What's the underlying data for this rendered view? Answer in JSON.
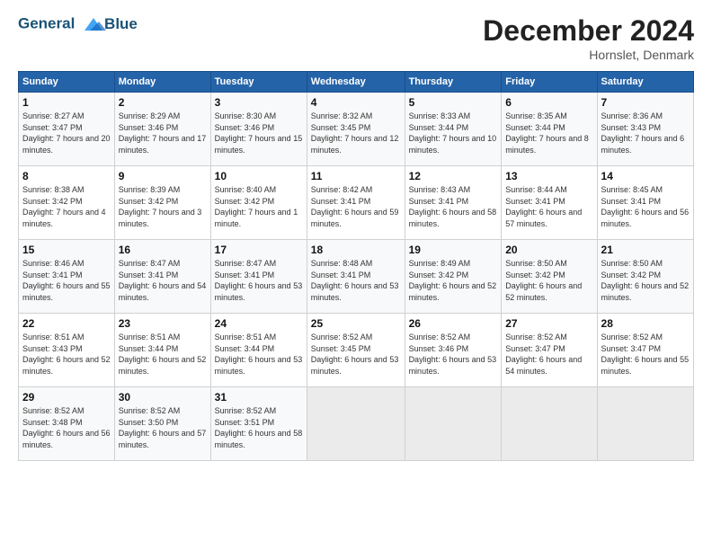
{
  "logo": {
    "line1": "General",
    "line2": "Blue"
  },
  "title": "December 2024",
  "location": "Hornslet, Denmark",
  "weekdays": [
    "Sunday",
    "Monday",
    "Tuesday",
    "Wednesday",
    "Thursday",
    "Friday",
    "Saturday"
  ],
  "weeks": [
    [
      {
        "day": "1",
        "sunrise": "8:27 AM",
        "sunset": "3:47 PM",
        "daylight": "7 hours and 20 minutes."
      },
      {
        "day": "2",
        "sunrise": "8:29 AM",
        "sunset": "3:46 PM",
        "daylight": "7 hours and 17 minutes."
      },
      {
        "day": "3",
        "sunrise": "8:30 AM",
        "sunset": "3:46 PM",
        "daylight": "7 hours and 15 minutes."
      },
      {
        "day": "4",
        "sunrise": "8:32 AM",
        "sunset": "3:45 PM",
        "daylight": "7 hours and 12 minutes."
      },
      {
        "day": "5",
        "sunrise": "8:33 AM",
        "sunset": "3:44 PM",
        "daylight": "7 hours and 10 minutes."
      },
      {
        "day": "6",
        "sunrise": "8:35 AM",
        "sunset": "3:44 PM",
        "daylight": "7 hours and 8 minutes."
      },
      {
        "day": "7",
        "sunrise": "8:36 AM",
        "sunset": "3:43 PM",
        "daylight": "7 hours and 6 minutes."
      }
    ],
    [
      {
        "day": "8",
        "sunrise": "8:38 AM",
        "sunset": "3:42 PM",
        "daylight": "7 hours and 4 minutes."
      },
      {
        "day": "9",
        "sunrise": "8:39 AM",
        "sunset": "3:42 PM",
        "daylight": "7 hours and 3 minutes."
      },
      {
        "day": "10",
        "sunrise": "8:40 AM",
        "sunset": "3:42 PM",
        "daylight": "7 hours and 1 minute."
      },
      {
        "day": "11",
        "sunrise": "8:42 AM",
        "sunset": "3:41 PM",
        "daylight": "6 hours and 59 minutes."
      },
      {
        "day": "12",
        "sunrise": "8:43 AM",
        "sunset": "3:41 PM",
        "daylight": "6 hours and 58 minutes."
      },
      {
        "day": "13",
        "sunrise": "8:44 AM",
        "sunset": "3:41 PM",
        "daylight": "6 hours and 57 minutes."
      },
      {
        "day": "14",
        "sunrise": "8:45 AM",
        "sunset": "3:41 PM",
        "daylight": "6 hours and 56 minutes."
      }
    ],
    [
      {
        "day": "15",
        "sunrise": "8:46 AM",
        "sunset": "3:41 PM",
        "daylight": "6 hours and 55 minutes."
      },
      {
        "day": "16",
        "sunrise": "8:47 AM",
        "sunset": "3:41 PM",
        "daylight": "6 hours and 54 minutes."
      },
      {
        "day": "17",
        "sunrise": "8:47 AM",
        "sunset": "3:41 PM",
        "daylight": "6 hours and 53 minutes."
      },
      {
        "day": "18",
        "sunrise": "8:48 AM",
        "sunset": "3:41 PM",
        "daylight": "6 hours and 53 minutes."
      },
      {
        "day": "19",
        "sunrise": "8:49 AM",
        "sunset": "3:42 PM",
        "daylight": "6 hours and 52 minutes."
      },
      {
        "day": "20",
        "sunrise": "8:50 AM",
        "sunset": "3:42 PM",
        "daylight": "6 hours and 52 minutes."
      },
      {
        "day": "21",
        "sunrise": "8:50 AM",
        "sunset": "3:42 PM",
        "daylight": "6 hours and 52 minutes."
      }
    ],
    [
      {
        "day": "22",
        "sunrise": "8:51 AM",
        "sunset": "3:43 PM",
        "daylight": "6 hours and 52 minutes."
      },
      {
        "day": "23",
        "sunrise": "8:51 AM",
        "sunset": "3:44 PM",
        "daylight": "6 hours and 52 minutes."
      },
      {
        "day": "24",
        "sunrise": "8:51 AM",
        "sunset": "3:44 PM",
        "daylight": "6 hours and 53 minutes."
      },
      {
        "day": "25",
        "sunrise": "8:52 AM",
        "sunset": "3:45 PM",
        "daylight": "6 hours and 53 minutes."
      },
      {
        "day": "26",
        "sunrise": "8:52 AM",
        "sunset": "3:46 PM",
        "daylight": "6 hours and 53 minutes."
      },
      {
        "day": "27",
        "sunrise": "8:52 AM",
        "sunset": "3:47 PM",
        "daylight": "6 hours and 54 minutes."
      },
      {
        "day": "28",
        "sunrise": "8:52 AM",
        "sunset": "3:47 PM",
        "daylight": "6 hours and 55 minutes."
      }
    ],
    [
      {
        "day": "29",
        "sunrise": "8:52 AM",
        "sunset": "3:48 PM",
        "daylight": "6 hours and 56 minutes."
      },
      {
        "day": "30",
        "sunrise": "8:52 AM",
        "sunset": "3:50 PM",
        "daylight": "6 hours and 57 minutes."
      },
      {
        "day": "31",
        "sunrise": "8:52 AM",
        "sunset": "3:51 PM",
        "daylight": "6 hours and 58 minutes."
      },
      null,
      null,
      null,
      null
    ]
  ]
}
